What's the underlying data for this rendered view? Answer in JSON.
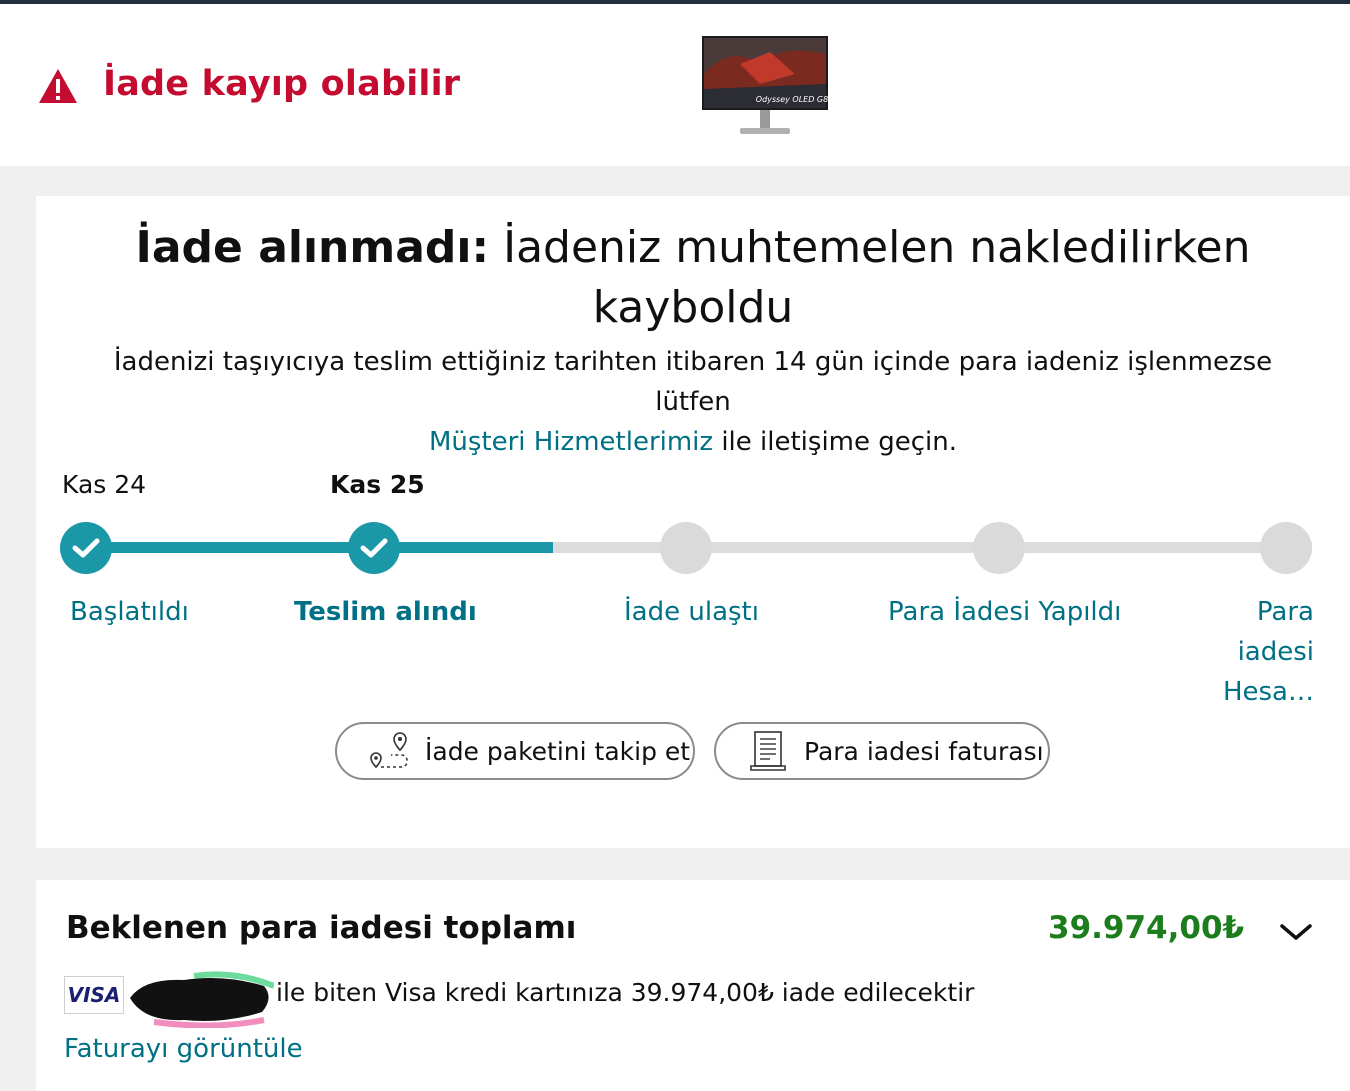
{
  "header": {
    "warning_text": "İade kayıp olabilir",
    "product_image_caption": "Odyssey OLED G8"
  },
  "status": {
    "headline_bold": "İade alınmadı:",
    "headline_rest": "İadeniz muhtemelen nakledilirken kayboldu",
    "subtext_before": "İadenizi taşıyıcıya teslim ettiğiniz tarihten itibaren 14 gün içinde para iadeniz işlenmezse lütfen",
    "subtext_link": "Müşteri Hizmetlerimiz",
    "subtext_after": "ile iletişime geçin."
  },
  "tracker": {
    "progress_fraction": 0.38,
    "steps": [
      {
        "date": "Kas 24",
        "label": "Başlatıldı",
        "state": "done"
      },
      {
        "date": "Kas 25",
        "label": "Teslim alındı",
        "state": "done"
      },
      {
        "date": "",
        "label": "İade ulaştı",
        "state": "pending"
      },
      {
        "date": "",
        "label": "Para İadesi Yapıldı",
        "state": "pending"
      },
      {
        "date": "",
        "label": "Para iadesi Hesa…",
        "state": "pending"
      }
    ]
  },
  "actions": {
    "track_label": "İade paketini takip et",
    "invoice_label": "Para iadesi faturası"
  },
  "refund": {
    "title": "Beklenen para iadesi toplamı",
    "amount": "39.974,00₺",
    "card_brand": "VISA",
    "card_text": "ile biten Visa kredi kartınıza 39.974,00₺ iade edilecektir",
    "view_invoice": "Faturayı görüntüle"
  },
  "colors": {
    "warning": "#c40c31",
    "link": "#007185",
    "progress": "#1a98a8",
    "amount": "#1b7d1b"
  }
}
